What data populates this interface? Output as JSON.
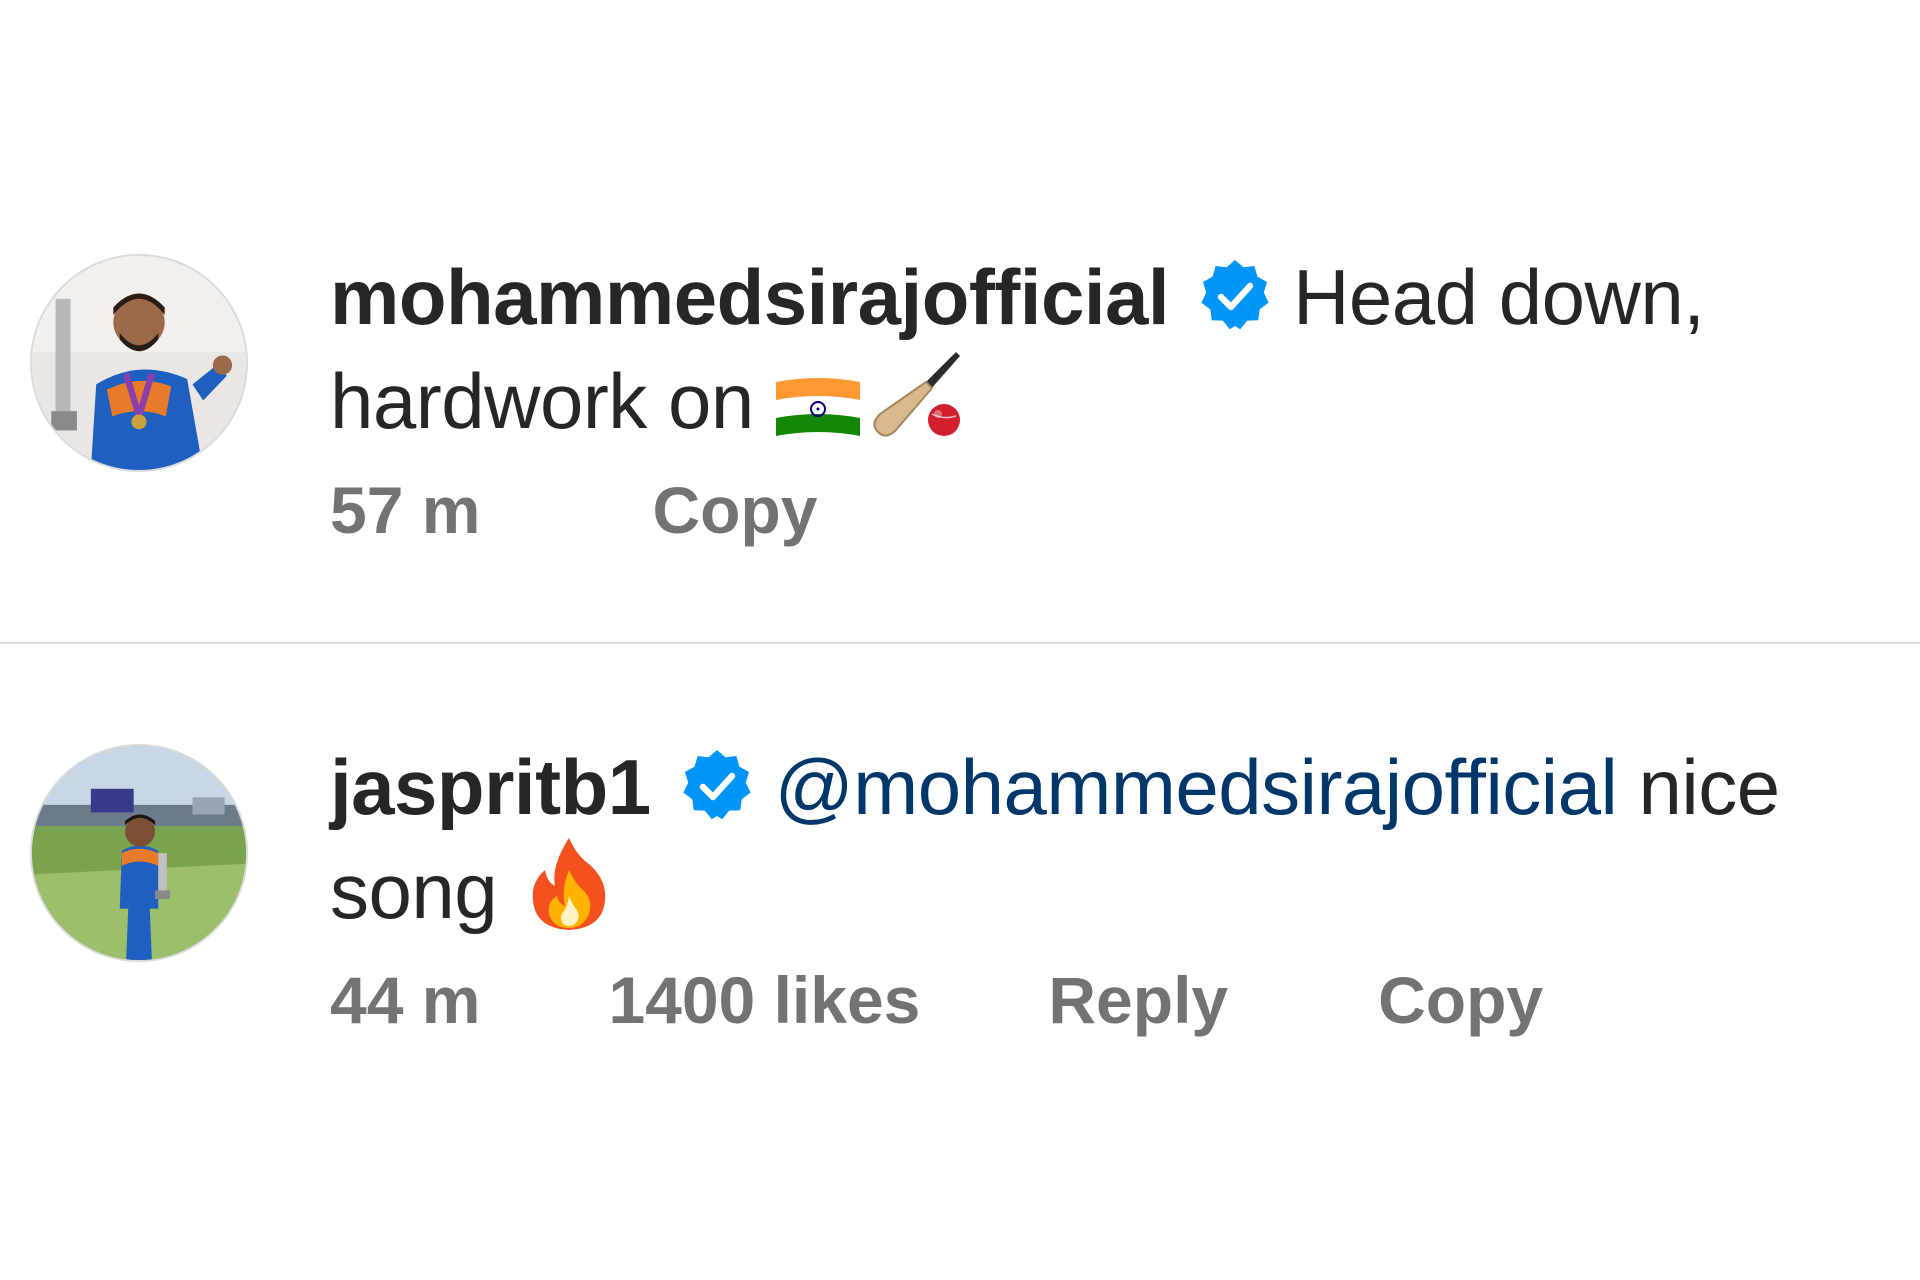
{
  "comments": [
    {
      "username": "mohammedsirajofficial",
      "verified": true,
      "line1_text": "Head down,",
      "line2_text": "hardwork on",
      "emojis": [
        "india-flag",
        "cricket-bat-and-ball"
      ],
      "time": "57 m",
      "actions": [
        "Copy"
      ]
    },
    {
      "username": "jaspritb1",
      "verified": true,
      "mention": "@mohammedsirajofficial",
      "line1_text": "nice",
      "line2_text": "song",
      "emojis": [
        "fire"
      ],
      "time": "44 m",
      "likes": "1400 likes",
      "actions": [
        "Reply",
        "Copy"
      ]
    }
  ],
  "colors": {
    "text": "#262626",
    "meta": "#737373",
    "mention": "#00376b",
    "verified_badge": "#0095f6",
    "divider": "#dbdbdb"
  }
}
